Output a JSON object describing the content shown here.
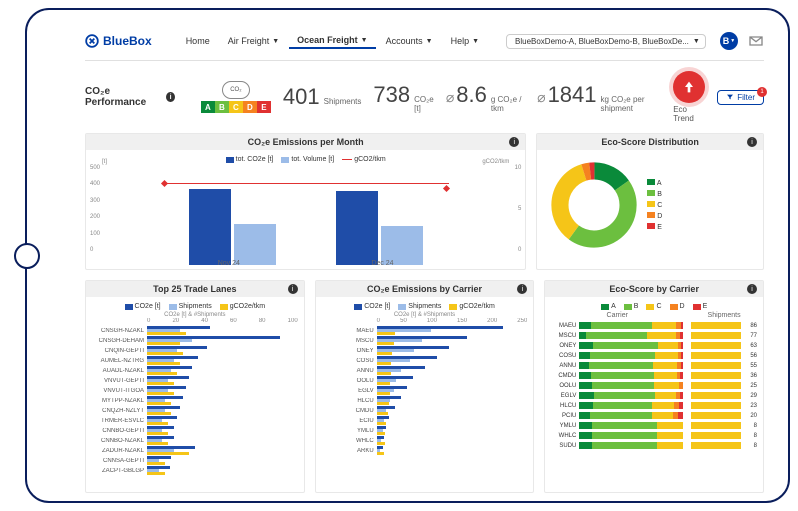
{
  "brand": "BlueBox",
  "nav": {
    "home": "Home",
    "air": "Air Freight",
    "ocean": "Ocean Freight",
    "accounts": "Accounts",
    "help": "Help"
  },
  "accountSelector": "BlueBoxDemo-A, BlueBoxDemo-B, BlueBoxDe...",
  "avatar": "B",
  "page_title": "CO₂e Performance",
  "metrics": {
    "shipments": {
      "value": "401",
      "label": "Shipments"
    },
    "co2e": {
      "value": "738",
      "label": "CO₂e [t]"
    },
    "gtkm": {
      "value": "8.6",
      "label": "g CO₂e / tkm"
    },
    "pership": {
      "value": "1841",
      "label": "kg CO₂e per shipment"
    }
  },
  "trend_label": "Eco Trend",
  "filter": {
    "label": "Filter",
    "count": "1"
  },
  "colors": {
    "blue": "#1f4da8",
    "lightblue": "#9cbce8",
    "yellow": "#f5c518",
    "green": "#6cbf3f",
    "darkgreen": "#0a8a3a",
    "orange": "#f58220",
    "red": "#e03131"
  },
  "panel_month": {
    "title": "CO₂e Emissions per Month",
    "legend": [
      "tot. CO2e [t]",
      "tot. Volume [t]",
      "gCO2/tkm"
    ],
    "y_left_label": "[t]",
    "y_right_label": "gCO2/tkm"
  },
  "panel_donut": {
    "title": "Eco-Score Distribution",
    "legend": [
      "A",
      "B",
      "C",
      "D",
      "E"
    ]
  },
  "panel_lanes": {
    "title": "Top 25 Trade Lanes",
    "legend": [
      "CO2e [t]",
      "Shipments",
      "gCO2e/tkm"
    ],
    "axis_label": "CO2e [t] & #Shipments"
  },
  "panel_carrier": {
    "title": "CO₂e Emissions by Carrier",
    "legend": [
      "CO2e [t]",
      "Shipments",
      "gCO2e/tkm"
    ],
    "axis_label": "CO2e [t] & #Shipments"
  },
  "panel_esc": {
    "title": "Eco-Score by Carrier",
    "legend": [
      "A",
      "B",
      "C",
      "D",
      "E"
    ],
    "col1": "Carrier",
    "col2": "Shipments"
  },
  "chart_data": [
    {
      "id": "emissions_per_month",
      "type": "bar",
      "categories": [
        "Nov 24",
        "Dec 24"
      ],
      "series": [
        {
          "name": "tot. CO2e [t]",
          "values": [
            450,
            440
          ],
          "color": "#1f4da8"
        },
        {
          "name": "tot. Volume [t]",
          "values": [
            240,
            230
          ],
          "color": "#9cbce8"
        },
        {
          "name": "gCO2/tkm",
          "values": [
            8.7,
            8.5
          ],
          "color": "#e03131",
          "type": "line",
          "yaxis": "right"
        }
      ],
      "y_left_ticks": [
        0,
        100,
        200,
        300,
        400,
        500
      ],
      "y_right_ticks": [
        0,
        5,
        10
      ],
      "xlabel": "",
      "ylabel": "[t]",
      "y2label": "gCO2/tkm"
    },
    {
      "id": "eco_score_distribution",
      "type": "pie",
      "categories": [
        "A",
        "B",
        "C",
        "D",
        "E"
      ],
      "values": [
        15,
        45,
        35,
        3,
        2
      ],
      "colors": [
        "#0a8a3a",
        "#6cbf3f",
        "#f5c518",
        "#f58220",
        "#e03131"
      ]
    },
    {
      "id": "top_25_trade_lanes",
      "type": "bar",
      "orientation": "horizontal",
      "x_ticks": [
        0,
        20,
        40,
        60,
        80,
        100
      ],
      "categories": [
        "CNSGH-NZAKL",
        "CNSGH-DEHAM",
        "CNQIN-GEPTI",
        "AUMEL-NZTRG",
        "AUADL-NZAKL",
        "VNVUT-GEPTI",
        "VNVUT-ITGOA",
        "MYTPP-NZAKL",
        "CNQZH-NZLYT",
        "TRMER-ESVLC",
        "CNNBO-GEPTI",
        "CNNBO-NZAKL",
        "ZADUR-NZAKL",
        "CNNSA-GEPTI",
        "ZACPT-GBLGP"
      ],
      "series": [
        {
          "name": "CO2e [t]",
          "values": [
            42,
            88,
            40,
            34,
            30,
            28,
            26,
            24,
            22,
            20,
            18,
            18,
            32,
            16,
            15
          ],
          "color": "#1f4da8"
        },
        {
          "name": "Shipments",
          "values": [
            22,
            30,
            20,
            18,
            16,
            14,
            14,
            12,
            12,
            10,
            10,
            10,
            18,
            8,
            8
          ],
          "color": "#9cbce8"
        },
        {
          "name": "gCO2e/tkm",
          "values": [
            26,
            22,
            24,
            22,
            20,
            18,
            18,
            16,
            16,
            14,
            14,
            14,
            28,
            12,
            12
          ],
          "color": "#f5c518"
        }
      ]
    },
    {
      "id": "emissions_by_carrier",
      "type": "bar",
      "orientation": "horizontal",
      "x_ticks": [
        0,
        50,
        100,
        150,
        200,
        250
      ],
      "categories": [
        "MAEU",
        "MSCU",
        "ONEY",
        "COSU",
        "ANNU",
        "OOLU",
        "EGLV",
        "HLCU",
        "CMDU",
        "ECIU",
        "YMLU",
        "WHLC",
        "ARKU"
      ],
      "series": [
        {
          "name": "CO2e [t]",
          "values": [
            210,
            150,
            120,
            100,
            80,
            60,
            50,
            40,
            30,
            20,
            15,
            12,
            10
          ],
          "color": "#1f4da8"
        },
        {
          "name": "Shipments",
          "values": [
            90,
            75,
            62,
            55,
            40,
            32,
            28,
            22,
            16,
            12,
            10,
            8,
            6
          ],
          "color": "#9cbce8"
        },
        {
          "name": "gCO2e/tkm",
          "values": [
            30,
            28,
            26,
            24,
            24,
            22,
            22,
            20,
            18,
            16,
            14,
            14,
            12
          ],
          "color": "#f5c518"
        }
      ]
    },
    {
      "id": "eco_score_by_carrier",
      "type": "bar",
      "orientation": "horizontal",
      "stacked": true,
      "categories": [
        "MAEU",
        "MSCU",
        "ONEY",
        "COSU",
        "ANNU",
        "CMDU",
        "OOLU",
        "EGLV",
        "HLCU",
        "PCIU",
        "YMLU",
        "WHLC",
        "SUDU"
      ],
      "shipments": [
        86,
        77,
        63,
        56,
        55,
        36,
        25,
        29,
        23,
        20,
        8,
        8,
        8
      ],
      "series": [
        {
          "name": "A",
          "color": "#0a8a3a",
          "values": [
            10,
            5,
            8,
            6,
            5,
            4,
            3,
            4,
            3,
            2,
            1,
            1,
            1
          ]
        },
        {
          "name": "B",
          "color": "#6cbf3f",
          "values": [
            50,
            45,
            40,
            35,
            34,
            22,
            15,
            17,
            13,
            12,
            5,
            5,
            5
          ]
        },
        {
          "name": "C",
          "color": "#f5c518",
          "values": [
            20,
            22,
            12,
            12,
            13,
            8,
            6,
            6,
            5,
            4,
            2,
            2,
            2
          ]
        },
        {
          "name": "D",
          "color": "#f58220",
          "values": [
            4,
            3,
            2,
            2,
            2,
            1,
            1,
            1,
            1,
            1,
            0,
            0,
            0
          ]
        },
        {
          "name": "E",
          "color": "#e03131",
          "values": [
            2,
            2,
            1,
            1,
            1,
            1,
            0,
            1,
            1,
            1,
            0,
            0,
            0
          ]
        }
      ]
    }
  ]
}
